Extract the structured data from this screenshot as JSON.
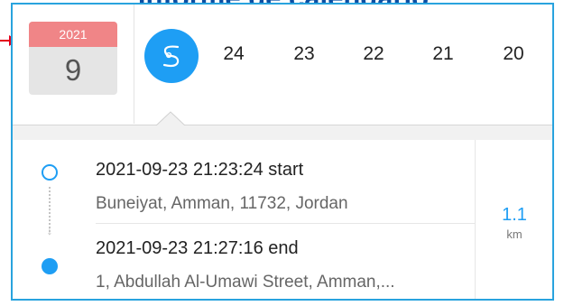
{
  "banner": {
    "title": "Informe de calendario"
  },
  "calendar": {
    "year": "2021",
    "day": "9"
  },
  "date_strip": {
    "route_icon": "route-s-icon",
    "days": [
      "24",
      "23",
      "22",
      "21",
      "20"
    ]
  },
  "trip": {
    "start_time": "2021-09-23 21:23:24 start",
    "start_address": "Buneiyat, Amman, 11732, Jordan",
    "end_time": "2021-09-23 21:27:16 end",
    "end_address": "1, Abdullah Al-Umawi Street, Amman,...",
    "distance_value": "1.1",
    "distance_unit": "km"
  },
  "colors": {
    "accent": "#1e9ef4",
    "calendar_header": "#f08587",
    "banner_text": "#0b4fa3",
    "pointer_arrow": "#e3001b",
    "panel_border": "#29a3de"
  }
}
